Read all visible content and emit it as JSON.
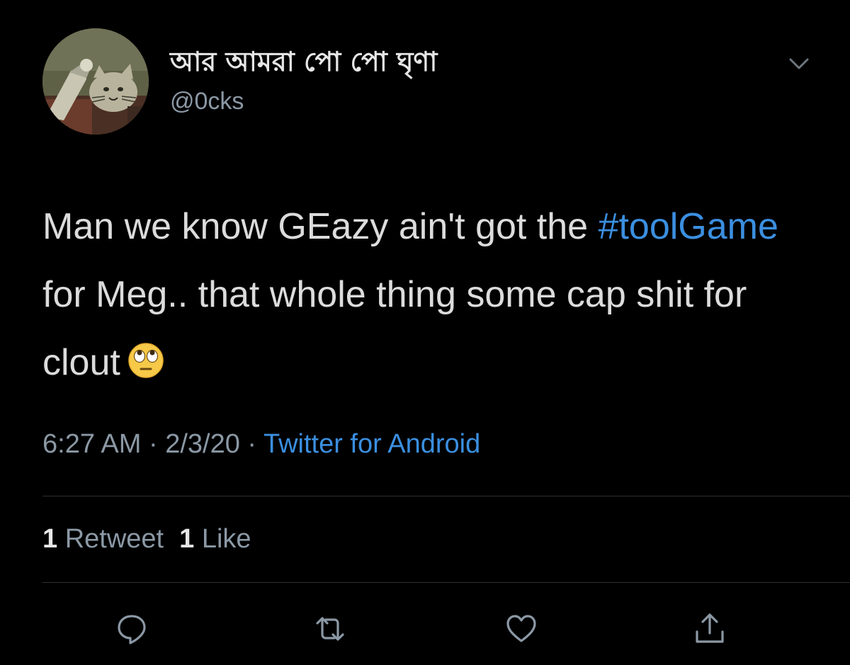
{
  "author": {
    "display_name": "আর আমরা পো পো ঘৃণা",
    "handle": "@0cks"
  },
  "tweet": {
    "text_part1": "Man we know GEazy ain't got the ",
    "hashtag": "#toolGame",
    "text_part2": " for Meg.. that whole thing some cap shit for clout",
    "emoji": "face-with-rolling-eyes"
  },
  "meta": {
    "time": "6:27 AM",
    "separator": "·",
    "date": "2/3/20",
    "source": "Twitter for Android"
  },
  "stats": {
    "retweets_count": "1",
    "retweets_label": "Retweet",
    "likes_count": "1",
    "likes_label": "Like"
  },
  "actions": [
    "reply-icon",
    "retweet-icon",
    "like-icon",
    "share-icon"
  ],
  "colors": {
    "background": "#000000",
    "link": "#3b8fe0",
    "secondary_text": "#8b98a5",
    "divider": "#2c2f33"
  }
}
